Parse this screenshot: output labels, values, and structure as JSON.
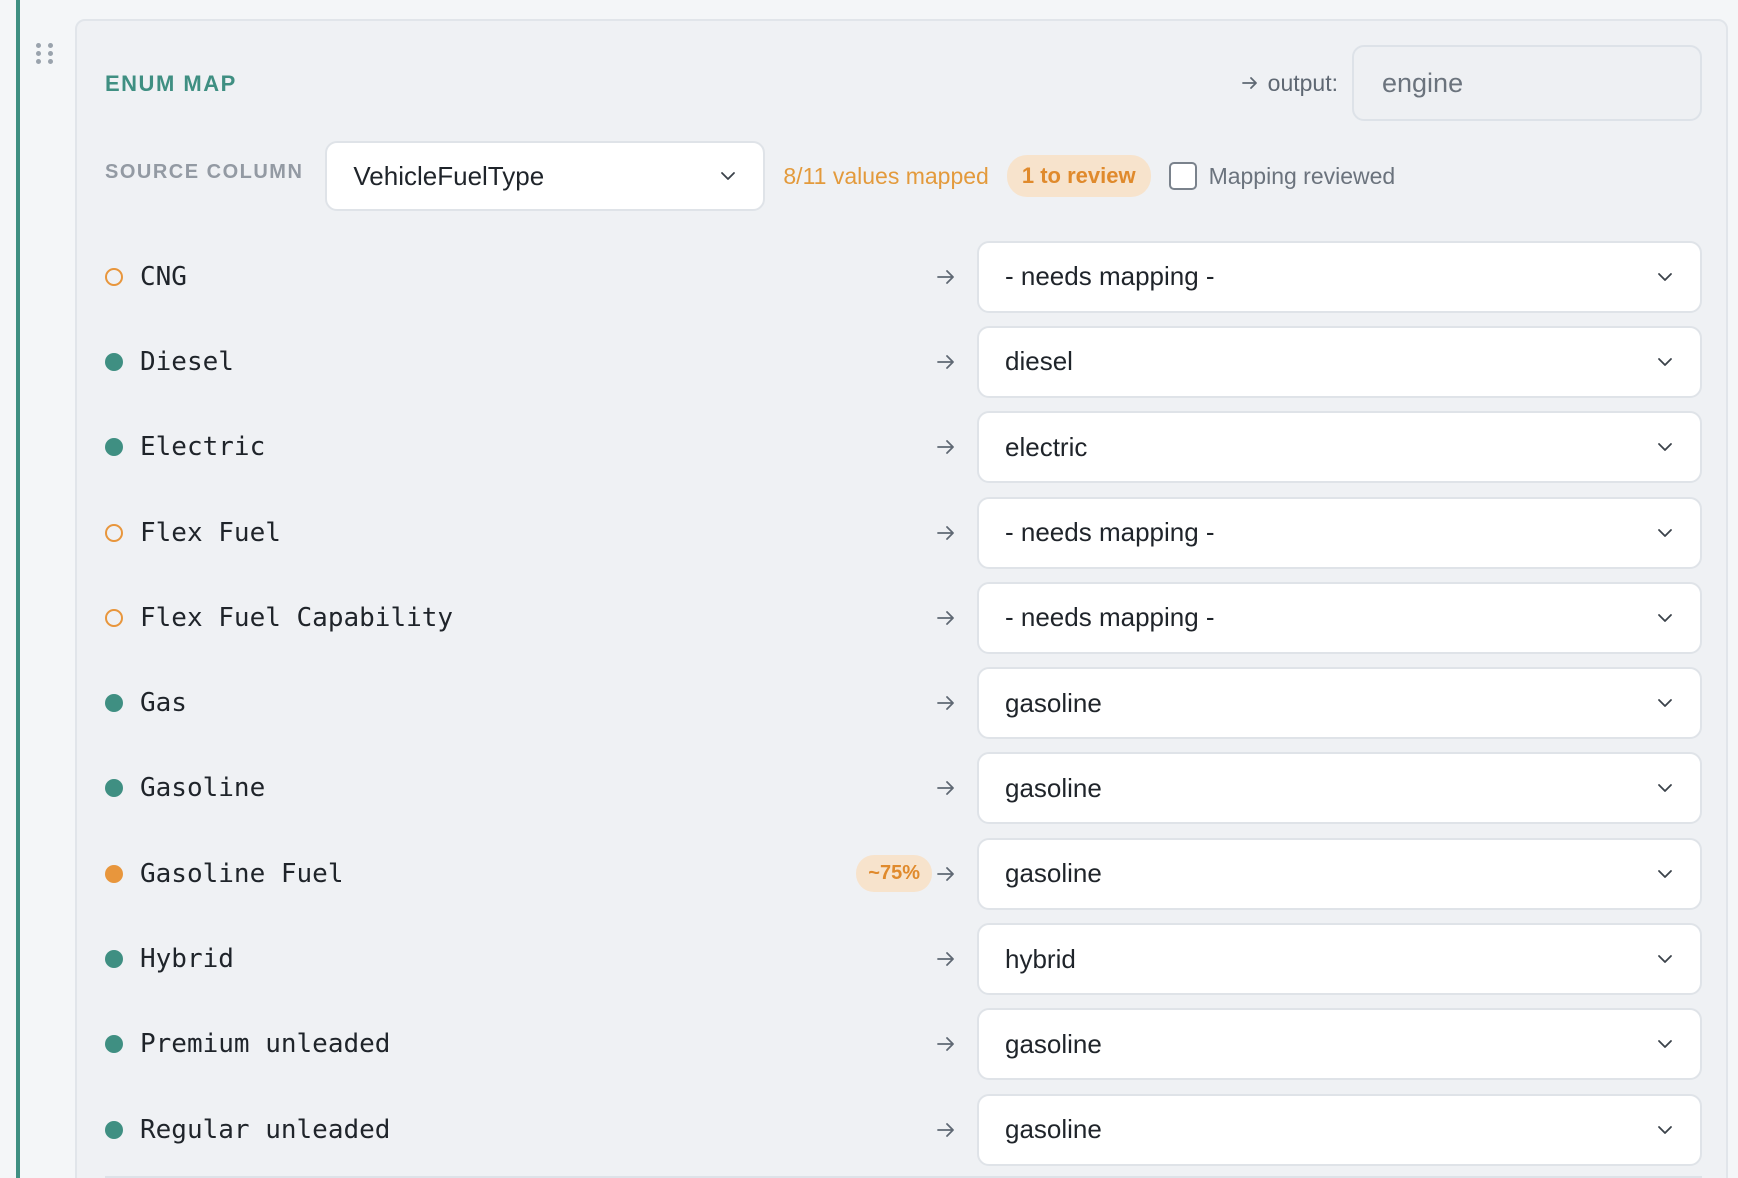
{
  "card": {
    "title": "ENUM MAP",
    "output_label": "output:",
    "output_value": "engine"
  },
  "source": {
    "label": "SOURCE COLUMN",
    "column": "VehicleFuelType",
    "mapped_count": "8/11 values mapped",
    "review_badge": "1 to review",
    "reviewed_label": "Mapping reviewed",
    "reviewed_checked": false
  },
  "rows": [
    {
      "source": "CNG",
      "status": "unmapped",
      "target": "- needs mapping -",
      "confidence": ""
    },
    {
      "source": "Diesel",
      "status": "mapped",
      "target": "diesel",
      "confidence": ""
    },
    {
      "source": "Electric",
      "status": "mapped",
      "target": "electric",
      "confidence": ""
    },
    {
      "source": "Flex Fuel",
      "status": "unmapped",
      "target": "- needs mapping -",
      "confidence": ""
    },
    {
      "source": "Flex Fuel Capability",
      "status": "unmapped",
      "target": "- needs mapping -",
      "confidence": ""
    },
    {
      "source": "Gas",
      "status": "mapped",
      "target": "gasoline",
      "confidence": ""
    },
    {
      "source": "Gasoline",
      "status": "mapped",
      "target": "gasoline",
      "confidence": ""
    },
    {
      "source": "Gasoline Fuel",
      "status": "review",
      "target": "gasoline",
      "confidence": "~75%"
    },
    {
      "source": "Hybrid",
      "status": "mapped",
      "target": "hybrid",
      "confidence": ""
    },
    {
      "source": "Premium unleaded",
      "status": "mapped",
      "target": "gasoline",
      "confidence": ""
    },
    {
      "source": "Regular unleaded",
      "status": "mapped",
      "target": "gasoline",
      "confidence": ""
    }
  ],
  "colors": {
    "accent": "#3f8f82",
    "warning": "#e8963c"
  },
  "icons": {
    "drag": "drag-handle-icon",
    "arrow": "arrow-right-icon",
    "chevron": "chevron-down-icon",
    "status_mapped": "filled-dot-icon",
    "status_unmapped": "hollow-dot-icon"
  }
}
